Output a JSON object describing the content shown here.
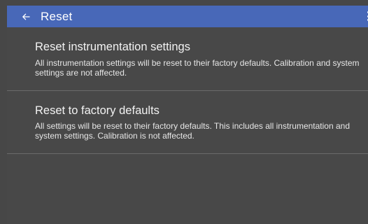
{
  "appbar": {
    "title": "Reset",
    "back_icon": "arrow-left-icon",
    "overflow_icon": "more-vert-icon",
    "color": "#4868b8"
  },
  "options": [
    {
      "title": "Reset instrumentation settings",
      "description": "All instrumentation settings will be reset to their factory defaults. Calibration and system settings are not affected."
    },
    {
      "title": "Reset to factory defaults",
      "description": "All settings will be reset to their factory defaults. This includes all instrumentation and system settings. Calibration is not affected."
    }
  ],
  "colors": {
    "background": "#474747",
    "divider": "#6a6a6a",
    "text": "#f2f2f2"
  }
}
